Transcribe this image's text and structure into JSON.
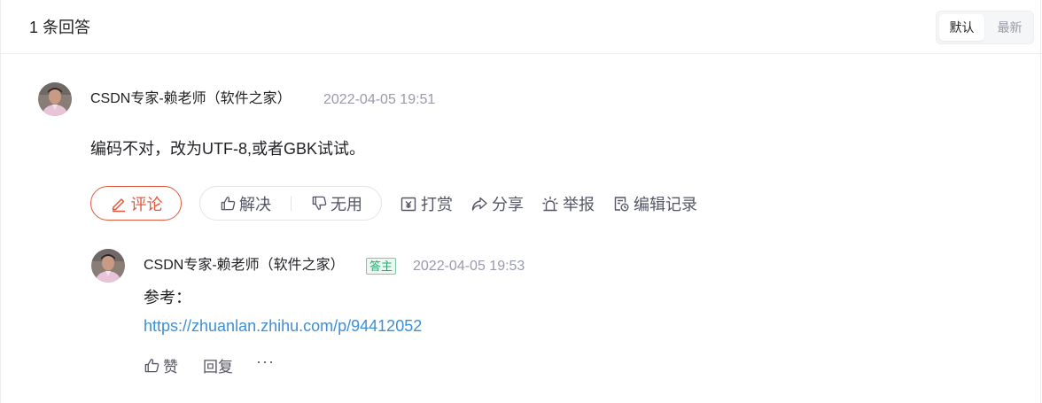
{
  "header": {
    "title": "1 条回答",
    "sort_options": [
      "默认",
      "最新"
    ],
    "sort_selected": "默认"
  },
  "answer": {
    "author": "CSDN专家-赖老师（软件之家）",
    "time": "2022-04-05 19:51",
    "content": "编码不对，改为UTF-8,或者GBK试试。",
    "actions": {
      "comment": "评论",
      "solve": "解决",
      "useless": "无用",
      "reward": "打赏",
      "share": "分享",
      "report": "举报",
      "edit_history": "编辑记录"
    },
    "icons": [
      "edit-pen-icon",
      "thumbs-up-icon",
      "thumbs-down-icon",
      "reward-icon",
      "share-icon",
      "report-icon",
      "edit-history-icon"
    ],
    "accent_color": "#e4583d"
  },
  "reply": {
    "author": "CSDN专家-赖老师（软件之家）",
    "badge": "答主",
    "time": "2022-04-05 19:53",
    "text": "参考：",
    "link": "https://zhuanlan.zhihu.com/p/94412052",
    "actions": {
      "like": "赞",
      "reply": "回复",
      "more": "···"
    },
    "link_color": "#3d8fd8",
    "badge_color": "#2ca96f"
  }
}
